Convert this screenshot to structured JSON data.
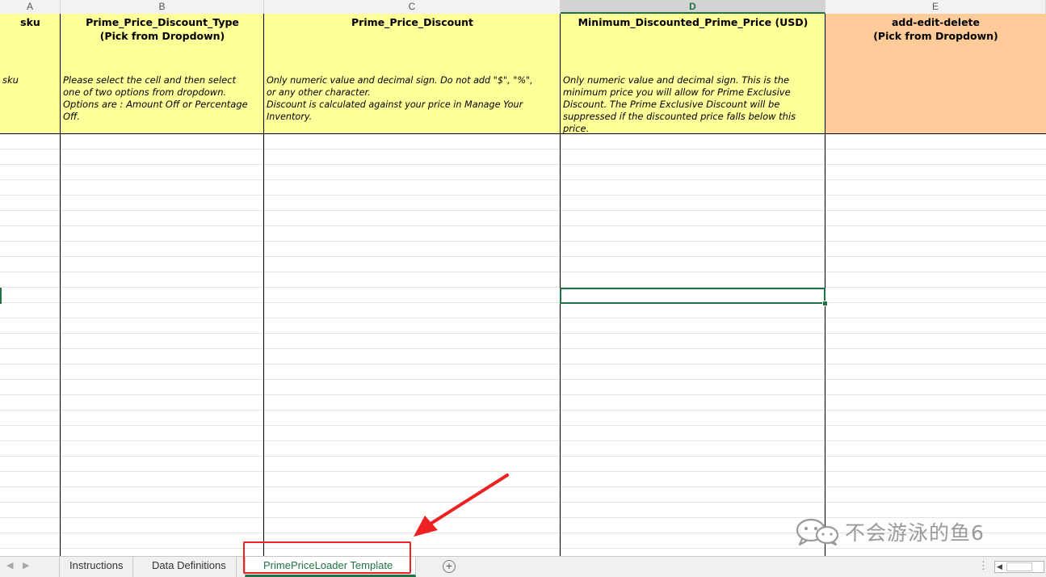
{
  "columns": [
    {
      "letter": "A",
      "title": "sku",
      "description": "sku"
    },
    {
      "letter": "B",
      "title": "Prime_Price_Discount_Type\n(Pick from Dropdown)",
      "description": "Please select the cell and then select\none of two options from dropdown.\nOptions are : Amount Off or Percentage\nOff."
    },
    {
      "letter": "C",
      "title": "Prime_Price_Discount",
      "description": "Only numeric value and decimal sign. Do not add \"$\", \"%\",\nor any other character.\nDiscount is calculated against your price in Manage Your\nInventory."
    },
    {
      "letter": "D",
      "title": "Minimum_Discounted_Prime_Price (USD)",
      "description": "Only numeric value and decimal sign. This is the\nminimum price you will allow for Prime Exclusive\nDiscount. The Prime Exclusive Discount will be\nsuppressed if the discounted price falls below this\nprice."
    },
    {
      "letter": "E",
      "title": "add-edit-delete\n(Pick from Dropdown)",
      "description": ""
    }
  ],
  "active_column": "D",
  "colors": {
    "header_yellow": "#ffff99",
    "header_orange": "#ffcc99",
    "selection_green": "#217346",
    "annotation_red": "#ee2222"
  },
  "tabs": [
    {
      "label": "Instructions",
      "active": false
    },
    {
      "label": "Data Definitions",
      "active": false
    },
    {
      "label": "PrimePriceLoader Template",
      "active": true
    }
  ],
  "icons": {
    "nav_left": "caret-left-icon",
    "nav_right": "caret-right-icon",
    "add_sheet": "plus-circle-icon",
    "tab_options": "vertical-ellipsis-icon",
    "watermark": "wechat-icon"
  },
  "watermark": {
    "text": "不会游泳的鱼6"
  }
}
